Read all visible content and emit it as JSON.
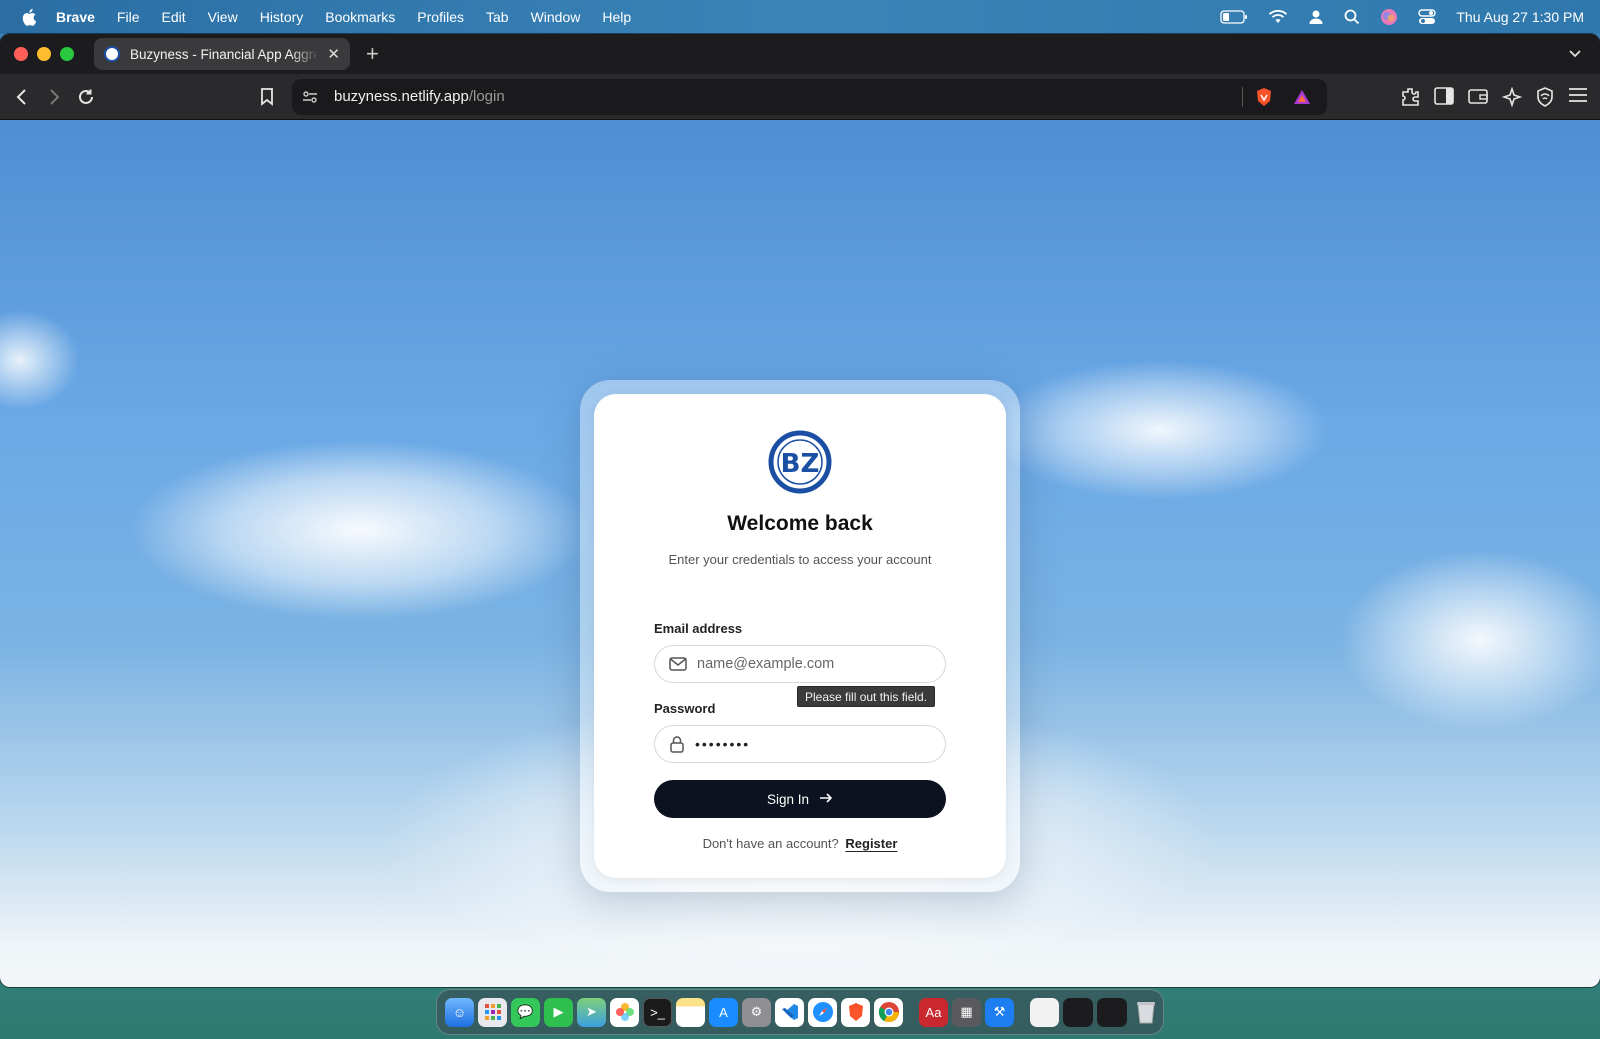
{
  "menubar": {
    "app": "Brave",
    "items": [
      "File",
      "Edit",
      "View",
      "History",
      "Bookmarks",
      "Profiles",
      "Tab",
      "Window",
      "Help"
    ],
    "clock": "Thu Aug 27  1:30 PM"
  },
  "browser": {
    "tab_title": "Buzyness - Financial App Aggregator",
    "url_host": "buzyness.netlify.app",
    "url_path": "/login"
  },
  "login": {
    "logo_text": "BZ",
    "title": "Welcome back",
    "subtitle": "Enter your credentials to access your account",
    "email_label": "Email address",
    "email_placeholder": "name@example.com",
    "email_value": "",
    "password_label": "Password",
    "password_value": "••••••••",
    "tooltip": "Please fill out this field.",
    "signin_label": "Sign In",
    "register_prompt": "Don't have an account?",
    "register_link": "Register"
  },
  "colors": {
    "accent": "#1a4fa3",
    "button": "#0c1220"
  },
  "dock": {
    "icons": [
      "finder-icon",
      "launchpad-icon",
      "messages-icon",
      "facetime-icon",
      "maps-icon",
      "photos-icon",
      "terminal-icon",
      "notes-icon",
      "app-store-icon",
      "settings-icon",
      "vscode-icon",
      "safari-icon",
      "brave-icon",
      "chrome-icon",
      "dictionary-icon",
      "calculator-icon",
      "xcode-icon",
      "document-icon",
      "window-thumb-icon",
      "window-thumb-icon",
      "trash-icon"
    ]
  }
}
